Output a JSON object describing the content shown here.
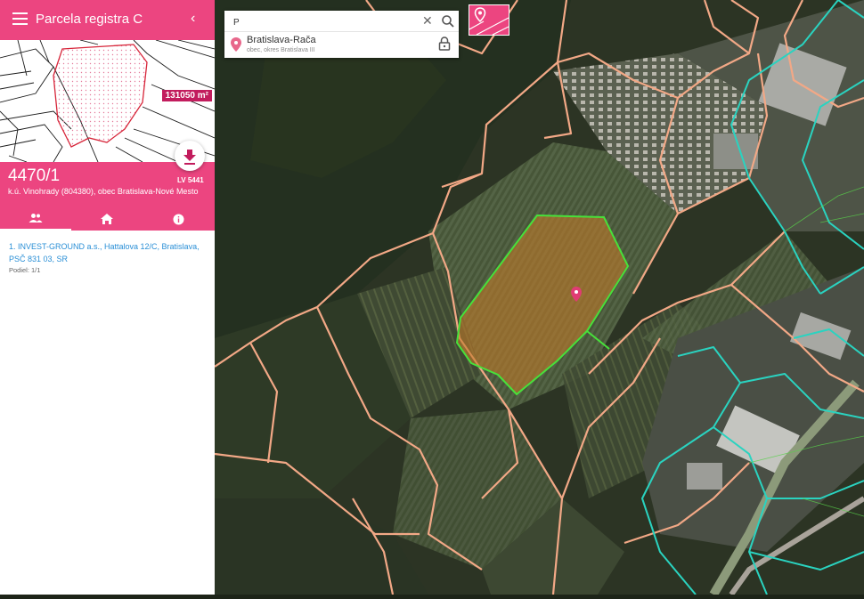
{
  "app": {
    "title": "Parcela registra C"
  },
  "parcel": {
    "area_badge": "131050 m²",
    "number": "4470/1",
    "location": "k.ú. Vinohrady (804380), obec Bratislava-Nové Mesto",
    "lv_label": "LV 5441"
  },
  "tabs": [
    {
      "icon": "people-icon",
      "active": true
    },
    {
      "icon": "home-icon",
      "active": false
    },
    {
      "icon": "info-icon",
      "active": false
    }
  ],
  "owners": [
    {
      "name": "1. INVEST-GROUND a.s., Hattalova 12/C, Bratislava, PSČ 831 03, SR",
      "share": "Podiel: 1/1"
    }
  ],
  "search": {
    "value": "P",
    "result_title": "Bratislava-Rača",
    "result_subtitle": "obec, okres Bratislava III"
  },
  "colors": {
    "brand": "#ec4580",
    "badge": "#c21c5d",
    "owner_link": "#2a8fd6",
    "parcel_outline": "#47e13a",
    "parcel_fill": "#c07a2a",
    "boundary_salmon": "#f2a886",
    "boundary_cyan": "#2ad3c0"
  }
}
